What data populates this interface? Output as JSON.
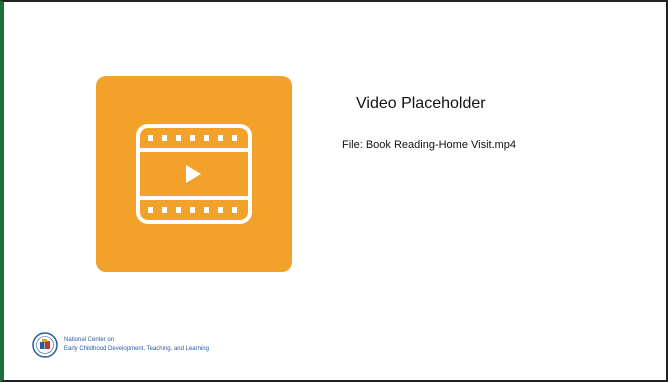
{
  "slide": {
    "accent_color": "#f2a22a",
    "border_color": "#1f6f3a",
    "title": "Video Placeholder",
    "file_line": "File: Book Reading-Home Visit.mp4"
  },
  "video": {
    "icon": "film-play-icon"
  },
  "logo": {
    "icon": "head-start-seal-icon",
    "line1": "National Center on",
    "line2": "Early Childhood Development, Teaching, and Learning"
  }
}
